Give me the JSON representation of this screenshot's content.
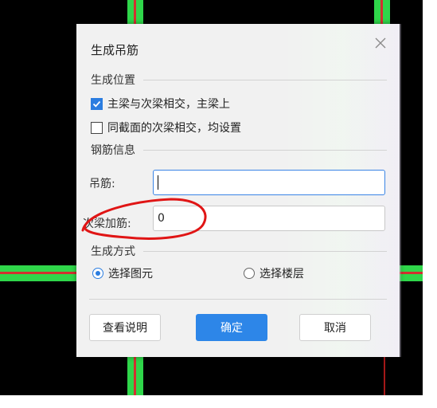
{
  "dialog": {
    "title": "生成吊筋",
    "close_icon": "close-icon",
    "section_position": "生成位置",
    "option_main_secondary": "主梁与次梁相交，主梁上",
    "option_main_secondary_checked": true,
    "option_same_section": "同截面的次梁相交，均设置",
    "option_same_section_checked": false,
    "section_rebar": "钢筋信息",
    "hanger_label": "吊筋:",
    "hanger_value": "",
    "secondary_label": "次梁加筋:",
    "secondary_value": "0",
    "section_method": "生成方式",
    "radio_select_element": "选择图元",
    "radio_select_floor": "选择楼层",
    "radio_selected": "选择图元",
    "btn_help": "查看说明",
    "btn_ok": "确定",
    "btn_cancel": "取消"
  },
  "colors": {
    "beam": "#2fd64a",
    "beam_core": "#d23030",
    "primary": "#2d86e8",
    "annotation": "#e01515"
  }
}
